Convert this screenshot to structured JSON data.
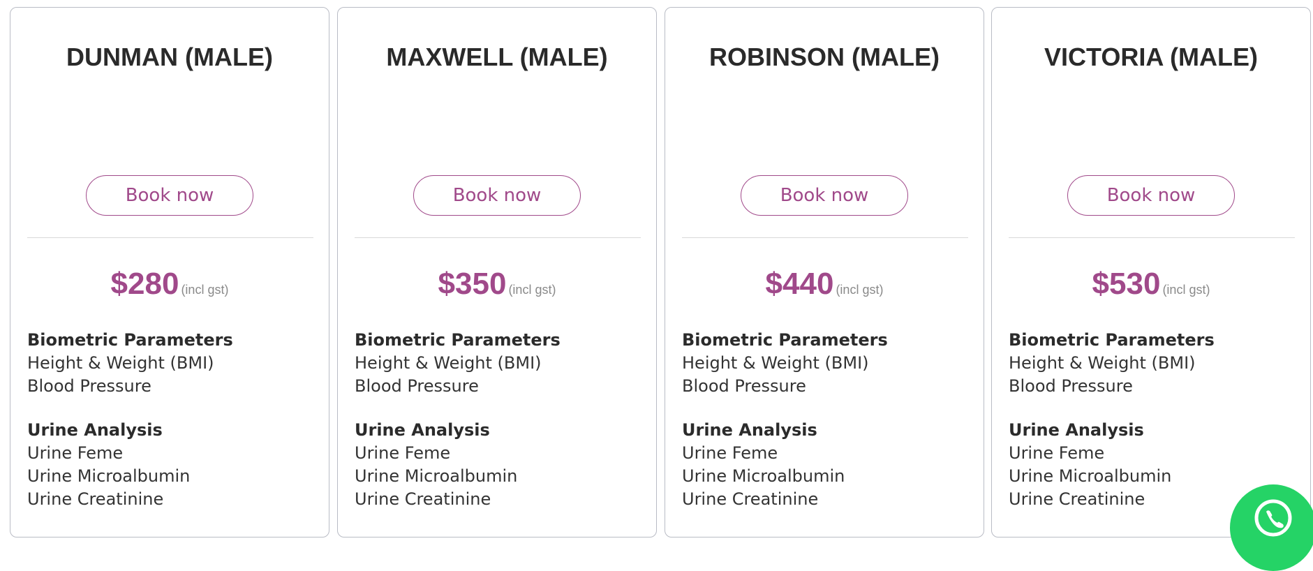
{
  "plans": [
    {
      "title": "DUNMAN (MALE)",
      "button_label": "Book now",
      "price": "$280",
      "price_note": "(incl gst)",
      "sections": [
        {
          "heading": "Biometric Parameters",
          "items": [
            "Height & Weight (BMI)",
            "Blood Pressure"
          ]
        },
        {
          "heading": "Urine Analysis",
          "items": [
            "Urine Feme",
            "Urine Microalbumin",
            "Urine Creatinine"
          ]
        }
      ]
    },
    {
      "title": "MAXWELL (MALE)",
      "button_label": "Book now",
      "price": "$350",
      "price_note": "(incl gst)",
      "sections": [
        {
          "heading": "Biometric Parameters",
          "items": [
            "Height & Weight (BMI)",
            "Blood Pressure"
          ]
        },
        {
          "heading": "Urine Analysis",
          "items": [
            "Urine Feme",
            "Urine Microalbumin",
            "Urine Creatinine"
          ]
        }
      ]
    },
    {
      "title": "ROBINSON (MALE)",
      "button_label": "Book now",
      "price": "$440",
      "price_note": "(incl gst)",
      "sections": [
        {
          "heading": "Biometric Parameters",
          "items": [
            "Height & Weight (BMI)",
            "Blood Pressure"
          ]
        },
        {
          "heading": "Urine Analysis",
          "items": [
            "Urine Feme",
            "Urine Microalbumin",
            "Urine Creatinine"
          ]
        }
      ]
    },
    {
      "title": "VICTORIA (MALE)",
      "button_label": "Book now",
      "price": "$530",
      "price_note": "(incl gst)",
      "sections": [
        {
          "heading": "Biometric Parameters",
          "items": [
            "Height & Weight (BMI)",
            "Blood Pressure"
          ]
        },
        {
          "heading": "Urine Analysis",
          "items": [
            "Urine Feme",
            "Urine Microalbumin",
            "Urine Creatinine"
          ]
        }
      ]
    }
  ],
  "floating_button": {
    "icon": "whatsapp-icon"
  },
  "colors": {
    "accent": "#a0498a",
    "card_border": "#b9bcc5",
    "text": "#2f2f2f",
    "muted": "#8a8a8a",
    "whatsapp": "#25d366"
  }
}
